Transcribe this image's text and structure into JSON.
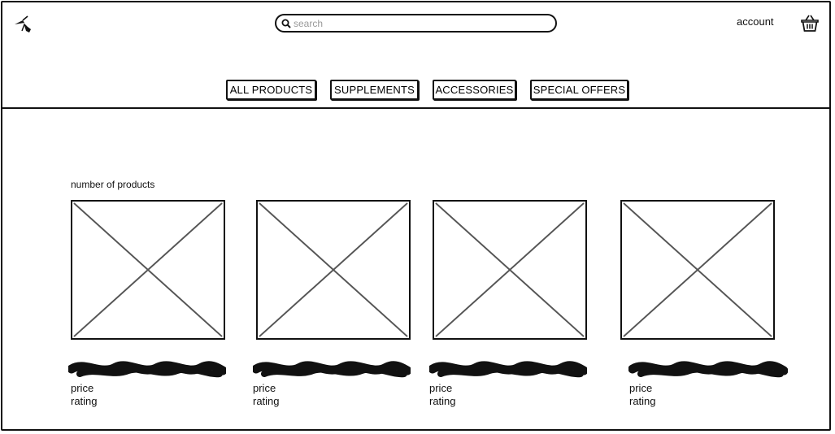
{
  "header": {
    "search": {
      "placeholder": "search",
      "value": ""
    },
    "account_label": "account"
  },
  "nav": {
    "items": [
      {
        "label": "ALL PRODUCTS"
      },
      {
        "label": "SUPPLEMENTS"
      },
      {
        "label": "ACCESSORIES"
      },
      {
        "label": "SPECIAL OFFERS"
      }
    ]
  },
  "main": {
    "product_count_label": "number of products",
    "products": [
      {
        "price_label": "price",
        "rating_label": "rating"
      },
      {
        "price_label": "price",
        "rating_label": "rating"
      },
      {
        "price_label": "price",
        "rating_label": "rating"
      },
      {
        "price_label": "price",
        "rating_label": "rating"
      }
    ]
  },
  "icons": {
    "logo": "logo-icon",
    "search": "search-icon",
    "basket": "basket-icon",
    "image_placeholder": "image-placeholder-icon"
  }
}
